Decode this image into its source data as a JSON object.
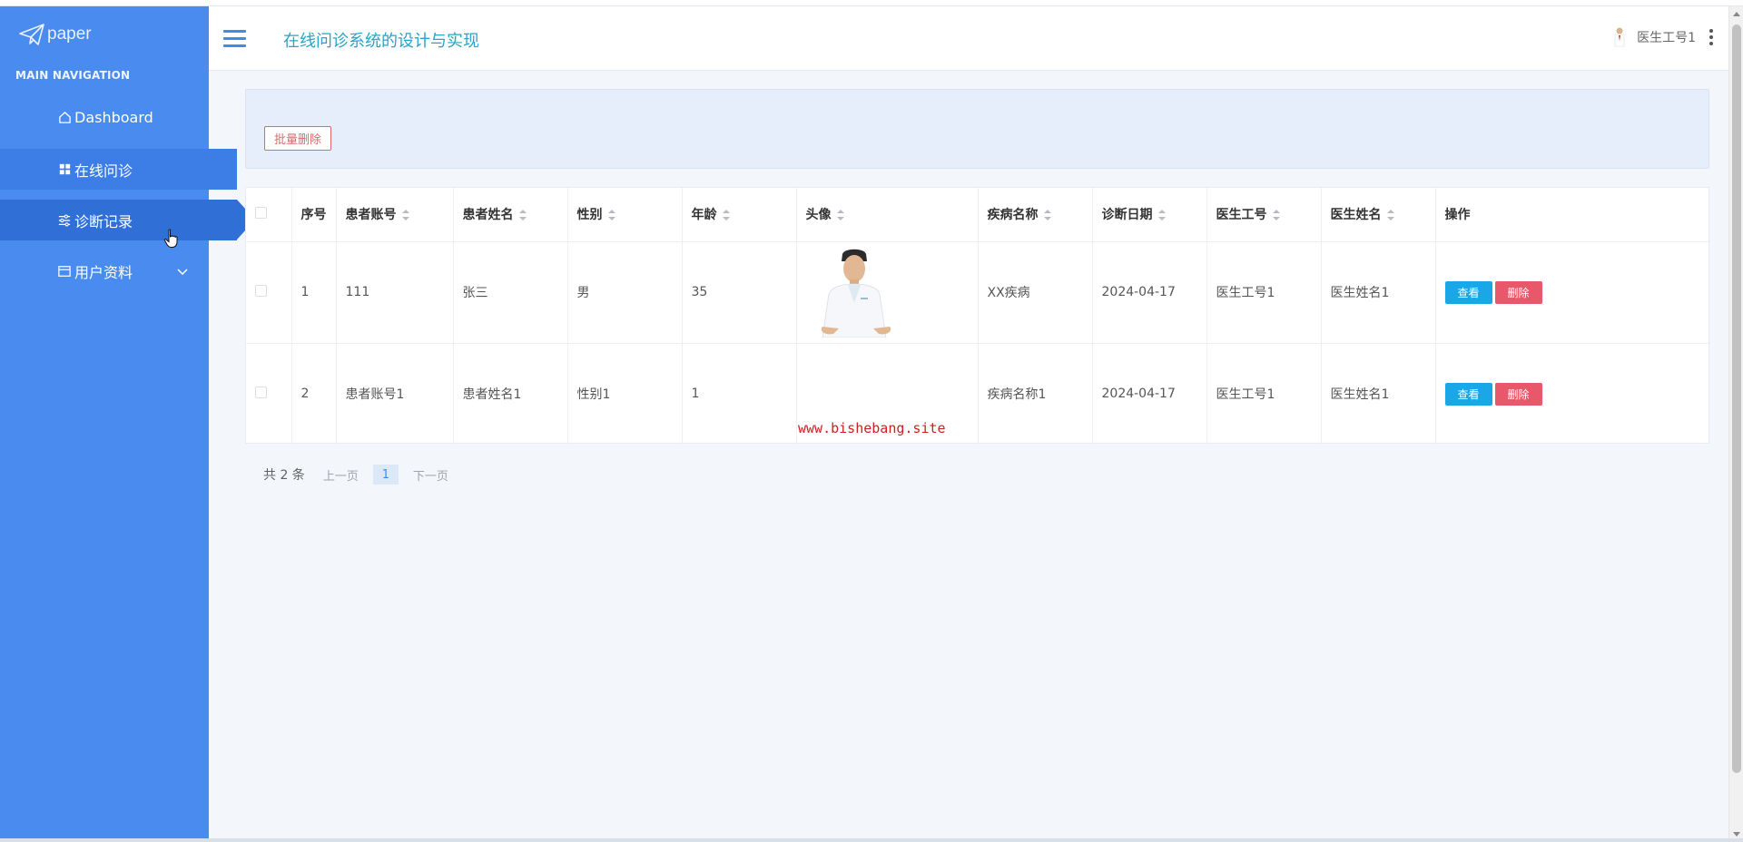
{
  "brand": {
    "logo_text": "paper"
  },
  "sidebar": {
    "heading": "MAIN NAVIGATION",
    "items": [
      {
        "label": "Dashboard",
        "icon": "home-icon"
      },
      {
        "label": "在线问诊",
        "icon": "grid-icon"
      },
      {
        "label": "诊断记录",
        "icon": "sliders-icon"
      },
      {
        "label": "用户资料",
        "icon": "id-card-icon"
      }
    ]
  },
  "header": {
    "title": "在线问诊系统的设计与实现",
    "user_name": "医生工号1"
  },
  "toolbar": {
    "batch_delete_label": "批量删除"
  },
  "table": {
    "columns": [
      "序号",
      "患者账号",
      "患者姓名",
      "性别",
      "年龄",
      "头像",
      "疾病名称",
      "诊断日期",
      "医生工号",
      "医生姓名",
      "操作"
    ],
    "rows": [
      {
        "index": "1",
        "account": "111",
        "name": "张三",
        "gender": "男",
        "age": "35",
        "disease": "XX疾病",
        "date": "2024-04-17",
        "doctor_id": "医生工号1",
        "doctor_name": "医生姓名1"
      },
      {
        "index": "2",
        "account": "患者账号1",
        "name": "患者姓名1",
        "gender": "性别1",
        "age": "1",
        "disease": "疾病名称1",
        "date": "2024-04-17",
        "doctor_id": "医生工号1",
        "doctor_name": "医生姓名1"
      }
    ],
    "view_label": "查看",
    "delete_label": "删除"
  },
  "watermark": "www.bishebang.site",
  "pagination": {
    "total": "共 2 条",
    "prev": "上一页",
    "current": "1",
    "next": "下一页"
  },
  "colors": {
    "sidebar": "#4a8bef",
    "sidebar_active": "#2f6fd6",
    "title": "#2aa3c9",
    "view_button": "#1aa7e8",
    "delete_button": "#e9586a"
  }
}
